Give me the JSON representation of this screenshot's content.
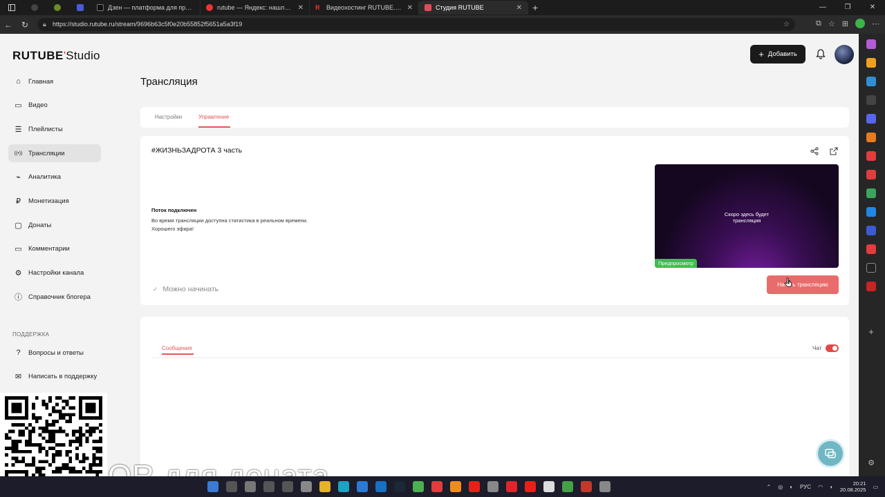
{
  "browser": {
    "tabs": [
      {
        "title": "Дзен — платформа для просмо",
        "active": false
      },
      {
        "title": "rutube — Яндекс: нашлось 1 мл",
        "active": false
      },
      {
        "title": "Видеохостинг RUTUBE. Смотрит",
        "active": false
      },
      {
        "title": "Студия RUTUBE",
        "active": true
      }
    ],
    "url": "https://studio.rutube.ru/stream/9696b63c5f0e20b55852f5651a5a3f19"
  },
  "app": {
    "logo_main": "RUTUBE",
    "logo_sub": "Studio",
    "header": {
      "add_label": "Добавить"
    },
    "page_title": "Трансляция",
    "sidebar": {
      "items": [
        {
          "label": "Главная",
          "icon": "home-icon"
        },
        {
          "label": "Видео",
          "icon": "video-icon"
        },
        {
          "label": "Плейлисты",
          "icon": "playlist-icon"
        },
        {
          "label": "Трансляции",
          "icon": "broadcast-icon",
          "active": true
        },
        {
          "label": "Аналитика",
          "icon": "analytics-icon"
        },
        {
          "label": "Монетизация",
          "icon": "ruble-icon"
        },
        {
          "label": "Донаты",
          "icon": "donate-icon"
        },
        {
          "label": "Комментарии",
          "icon": "comment-icon"
        },
        {
          "label": "Настройки канала",
          "icon": "gear-icon"
        },
        {
          "label": "Справочник блогера",
          "icon": "info-icon"
        }
      ],
      "support_label": "ПОДДЕРЖКА",
      "support_items": [
        {
          "label": "Вопросы и ответы",
          "icon": "faq-icon"
        },
        {
          "label": "Написать в поддержку",
          "icon": "support-icon"
        }
      ]
    },
    "tabs": {
      "settings": "Настройки",
      "manage": "Управление",
      "active": "manage"
    },
    "stream": {
      "title": "#ЖИЗНЬЗАДРОТА 3 часть",
      "status_title": "Поток подключен",
      "status_line1": "Во время трансляции доступна статистика в реальном времени.",
      "status_line2": "Хорошего эфира!",
      "preview_line1": "Скоро здесь будет",
      "preview_line2": "трансляция",
      "preview_badge": "Предпросмотр",
      "ready_text": "Можно начинать",
      "start_button": "Начать трансляцию"
    },
    "chat": {
      "messages_tab": "Сообщения",
      "toggle_label": "Чат",
      "enabled": true
    },
    "colors": {
      "accent": "#e35757",
      "start_button": "#ea6b6b",
      "badge": "#3bbf4c"
    }
  },
  "overlay": {
    "text": "QR для доната"
  },
  "taskbar": {
    "lang": "РУС",
    "time": "20:21",
    "date": "20.08.2025"
  }
}
